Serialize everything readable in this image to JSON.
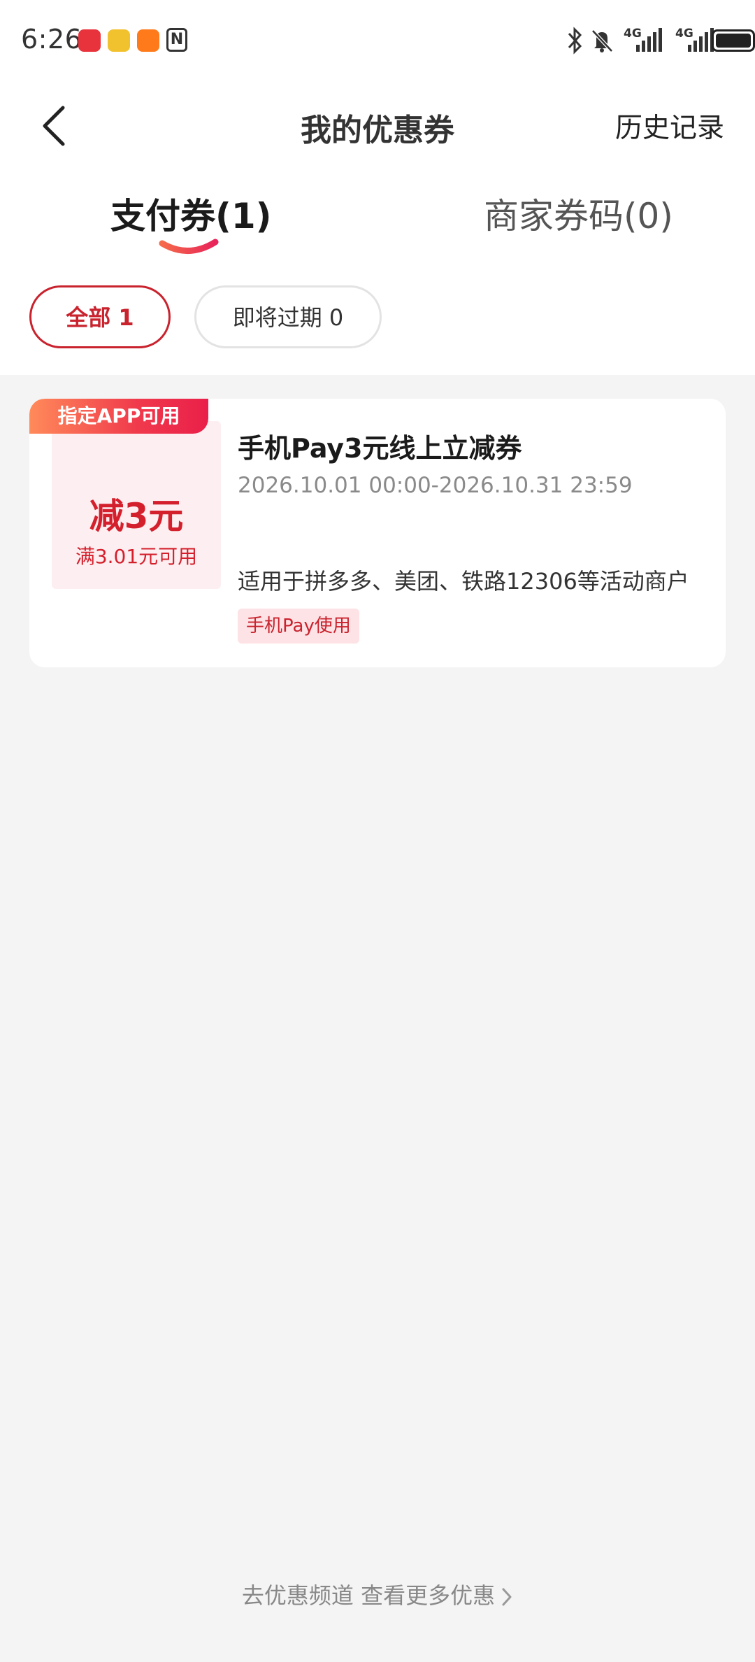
{
  "status_bar": {
    "time": "6:26",
    "apps": [
      "shop-app-icon",
      "weibo-icon",
      "orange-app-icon"
    ],
    "nfc_label": "N",
    "network": "4G",
    "icons": [
      "bluetooth-icon",
      "bell-muted-icon",
      "signal-icon",
      "signal-icon",
      "battery-icon"
    ]
  },
  "header": {
    "title": "我的优惠券",
    "history_label": "历史记录"
  },
  "tabs": [
    {
      "label": "支付券(1)",
      "active": true
    },
    {
      "label": "商家券码(0)",
      "active": false
    }
  ],
  "filters": [
    {
      "label": "全部 1",
      "active": true
    },
    {
      "label": "即将过期 0",
      "active": false
    }
  ],
  "coupon": {
    "badge": "指定APP可用",
    "amount": "减3元",
    "condition": "满3.01元可用",
    "title": "手机Pay3元线上立减券",
    "validity": "2026.10.01 00:00-2026.10.31 23:59",
    "scope": "适用于拼多多、美团、铁路12306等活动商户",
    "tag": "手机Pay使用"
  },
  "footer": {
    "link_label": "去优惠频道 查看更多优惠"
  },
  "colors": {
    "accent": "#c9232e",
    "badge_gradient_start": "#ff8a5a",
    "badge_gradient_end": "#ea1f4a",
    "page_bg": "#f4f4f4"
  }
}
